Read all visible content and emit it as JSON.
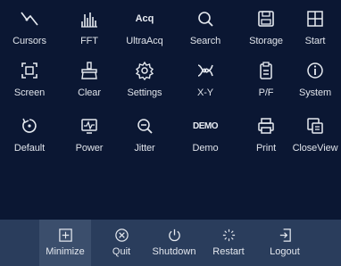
{
  "grid": [
    {
      "label": "Cursors",
      "icon": "cursors-icon"
    },
    {
      "label": "FFT",
      "icon": "fft-icon"
    },
    {
      "label": "UltraAcq",
      "icon": "acq-icon",
      "icon_text": "Acq"
    },
    {
      "label": "Search",
      "icon": "search-icon"
    },
    {
      "label": "Storage",
      "icon": "storage-icon"
    },
    {
      "label": "Start",
      "icon": "start-icon"
    },
    {
      "label": "Screen",
      "icon": "screen-icon"
    },
    {
      "label": "Clear",
      "icon": "clear-icon"
    },
    {
      "label": "Settings",
      "icon": "settings-icon"
    },
    {
      "label": "X-Y",
      "icon": "xy-icon"
    },
    {
      "label": "P/F",
      "icon": "pass-fail-icon"
    },
    {
      "label": "System",
      "icon": "system-icon"
    },
    {
      "label": "Default",
      "icon": "default-icon"
    },
    {
      "label": "Power",
      "icon": "power-analysis-icon"
    },
    {
      "label": "Jitter",
      "icon": "jitter-icon"
    },
    {
      "label": "Demo",
      "icon": "demo-icon",
      "icon_text": "DEMO"
    },
    {
      "label": "Print",
      "icon": "print-icon"
    },
    {
      "label": "CloseView",
      "icon": "closeview-icon"
    }
  ],
  "bottom": [
    {
      "label": "Minimize",
      "icon": "minimize-icon",
      "selected": true
    },
    {
      "label": "Quit",
      "icon": "quit-icon"
    },
    {
      "label": "Shutdown",
      "icon": "shutdown-icon"
    },
    {
      "label": "Restart",
      "icon": "restart-icon"
    },
    {
      "label": "Logout",
      "icon": "logout-icon"
    }
  ],
  "colors": {
    "background": "#0b1733",
    "bottom_bar": "#2a3d5c",
    "selected": "#3b4e6c",
    "text": "#dfe3ea"
  }
}
